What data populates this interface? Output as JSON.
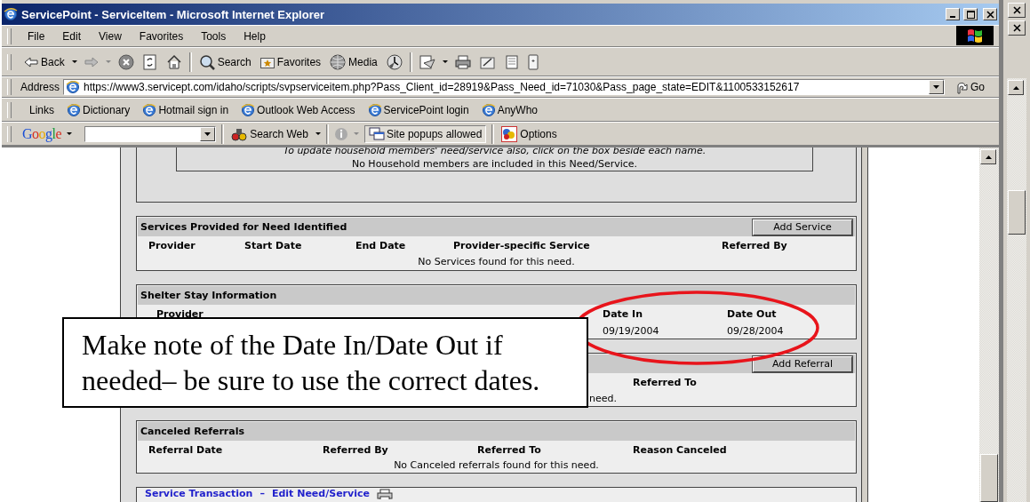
{
  "window": {
    "title": "ServicePoint - ServiceItem - Microsoft Internet Explorer"
  },
  "menu": [
    "File",
    "Edit",
    "View",
    "Favorites",
    "Tools",
    "Help"
  ],
  "toolbar": {
    "back": "Back",
    "search": "Search",
    "favorites": "Favorites",
    "media": "Media"
  },
  "address": {
    "label": "Address",
    "url": "https://www3.servicept.com/idaho/scripts/svpserviceitem.php?Pass_Client_id=28919&Pass_Need_id=71030&Pass_page_state=EDIT&1100533152617",
    "go": "Go"
  },
  "links": {
    "label": "Links",
    "items": [
      "Dictionary",
      "Hotmail sign in",
      "Outlook Web Access",
      "ServicePoint login",
      "AnyWho"
    ]
  },
  "google_bar": {
    "logo": "Google",
    "search_button": "Search Web",
    "popups": "Site popups allowed",
    "options": "Options"
  },
  "household": {
    "instruction": "To update household members' need/service also, click on the box beside each name.",
    "message": "No Household members are included in this Need/Service."
  },
  "services": {
    "title": "Services Provided for Need Identified",
    "button": "Add Service",
    "columns": [
      "Provider",
      "Start Date",
      "End Date",
      "Provider-specific Service",
      "Referred By"
    ],
    "message": "No Services found for this need."
  },
  "shelter": {
    "title": "Shelter Stay Information",
    "columns": [
      "Provider",
      "Date In",
      "Date Out"
    ],
    "row": [
      "09/19/2004",
      "09/28/2004"
    ]
  },
  "referrals": {
    "button": "Add Referral",
    "columns": [
      "Referred To"
    ],
    "message": "need."
  },
  "canceled": {
    "title": "Canceled Referrals",
    "columns": [
      "Referral Date",
      "Referred By",
      "Referred To",
      "Reason Canceled"
    ],
    "message": "No Canceled referrals found for this need."
  },
  "footer_links": {
    "items": [
      "Service Transaction",
      "Edit Need/Service"
    ],
    "separator": "–"
  },
  "callout": {
    "text": "Make note of the Date In/Date Out if needed– be sure to use the correct dates."
  }
}
